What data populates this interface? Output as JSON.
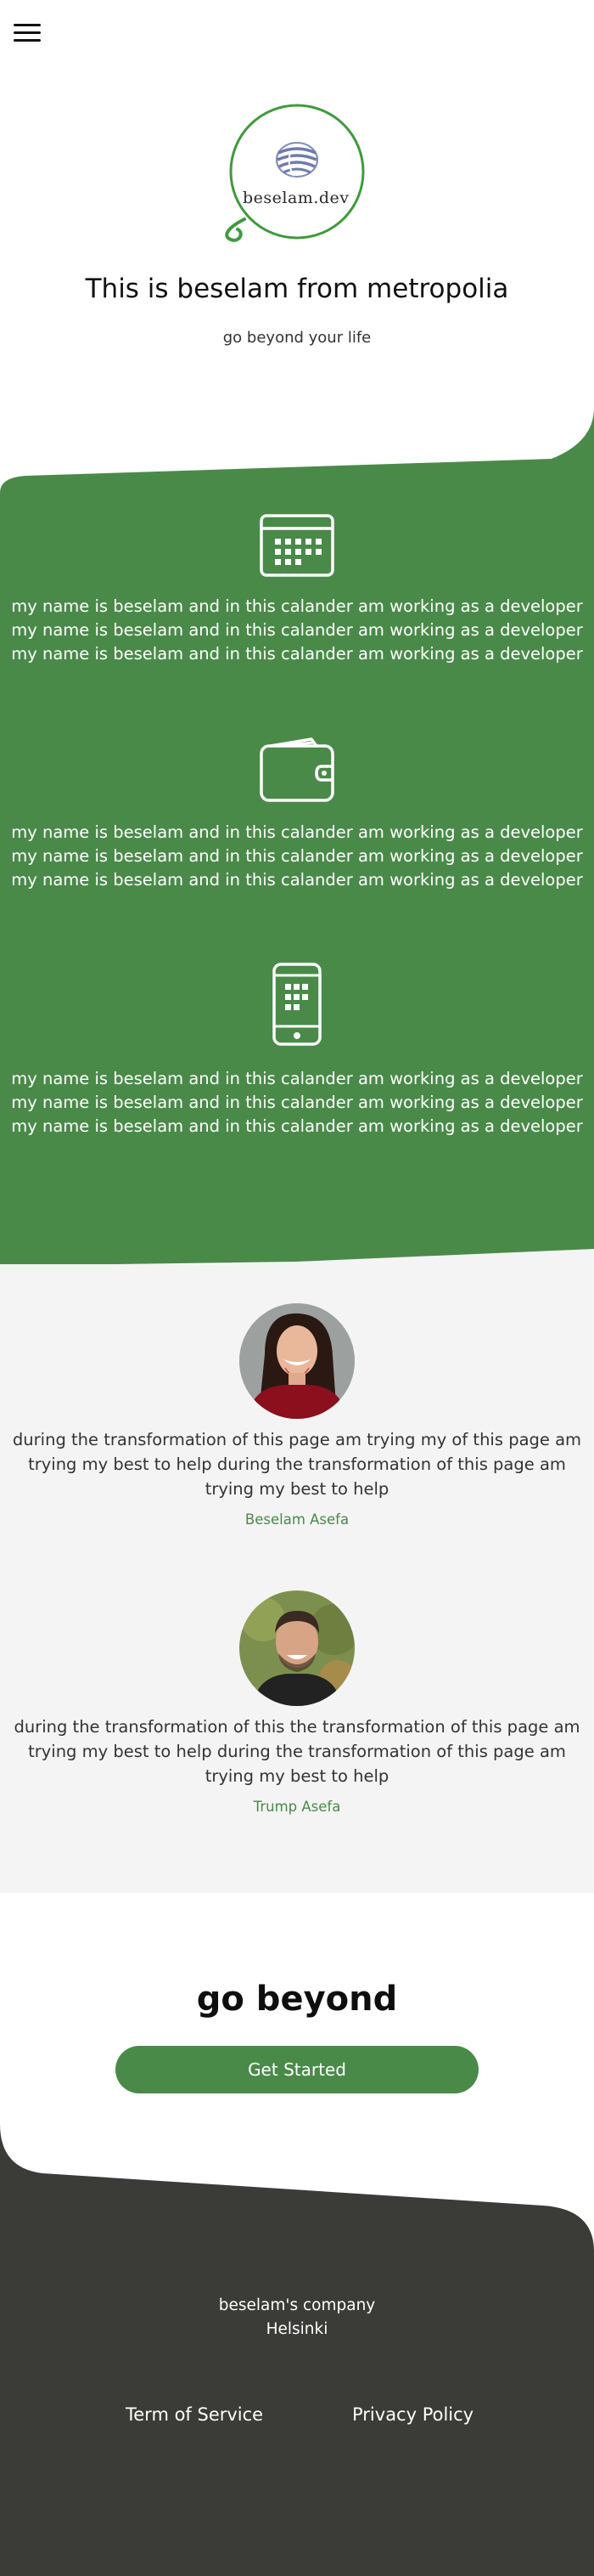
{
  "header": {
    "menu_icon": "hamburger-menu-icon",
    "logo_text": "beselam.dev",
    "title": "This is beselam from metropolia",
    "subtitle": "go beyond your life"
  },
  "features": [
    {
      "icon": "calendar-icon",
      "lines": [
        "my name is beselam and in this calander am working as a developer",
        "my name is beselam and in this calander am working as a developer",
        "my name is beselam and in this calander am working as a developer"
      ]
    },
    {
      "icon": "wallet-icon",
      "lines": [
        "my name is beselam and in this calander am working as a developer",
        "my name is beselam and in this calander am working as a developer",
        "my name is beselam and in this calander am working as a developer"
      ]
    },
    {
      "icon": "mobile-phone-icon",
      "lines": [
        "my name is beselam and in this calander am working as a developer",
        "my name is beselam and in this calander am working as a developer",
        "my name is beselam and in this calander am working as a developer"
      ]
    }
  ],
  "testimonials": [
    {
      "quote": "during the transformation of this page am trying my of this page am trying my best to help during the transformation of this page am trying my best to help",
      "author": "Beselam Asefa"
    },
    {
      "quote": "during the transformation of this the transformation of this page am trying my best to help during the transformation of this page am trying my best to help",
      "author": "Trump Asefa"
    }
  ],
  "cta": {
    "title": "go beyond",
    "button_label": "Get Started"
  },
  "footer": {
    "company_name": "beselam's company",
    "city": "Helsinki",
    "terms_label": "Term of Service",
    "privacy_label": "Privacy Policy"
  },
  "colors": {
    "brand_green": "#4a8a49",
    "footer_dark": "#3b3b38",
    "testimonial_bg": "#f4f4f4"
  }
}
